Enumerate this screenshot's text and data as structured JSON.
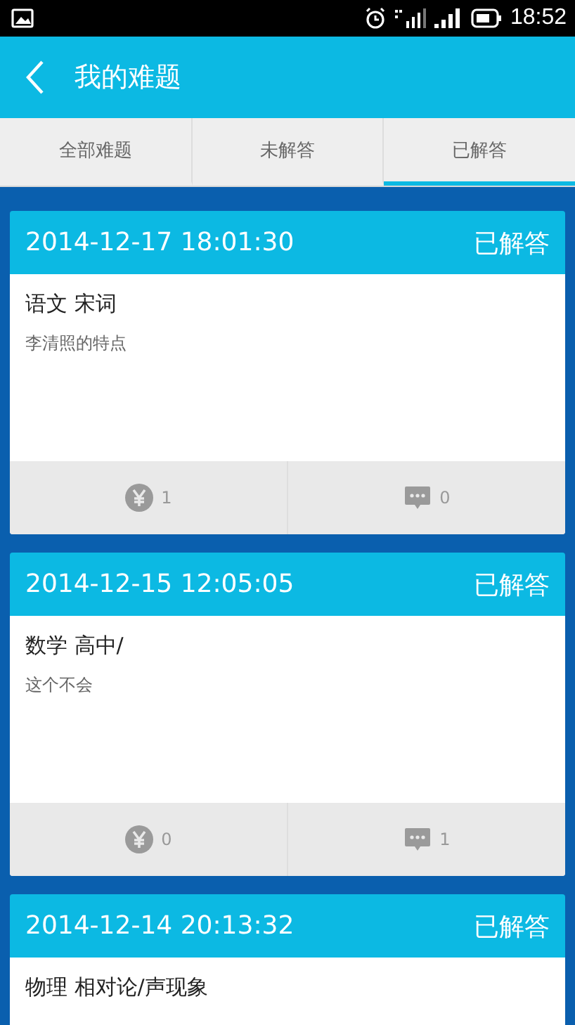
{
  "status_bar": {
    "time": "18:52"
  },
  "header": {
    "title": "我的难题"
  },
  "tabs": [
    {
      "label": "全部难题",
      "selected": false
    },
    {
      "label": "未解答",
      "selected": false
    },
    {
      "label": "已解答",
      "selected": true
    }
  ],
  "questions": [
    {
      "time": "2014-12-17 18:01:30",
      "status": "已解答",
      "subject": "语文 宋词",
      "text": "李清照的特点",
      "reward": "1",
      "comments": "0"
    },
    {
      "time": "2014-12-15 12:05:05",
      "status": "已解答",
      "subject": "数学 高中/",
      "text": "这个不会",
      "reward": "0",
      "comments": "1"
    },
    {
      "time": "2014-12-14 20:13:32",
      "status": "已解答",
      "subject": "物理 相对论/声现象"
    }
  ]
}
